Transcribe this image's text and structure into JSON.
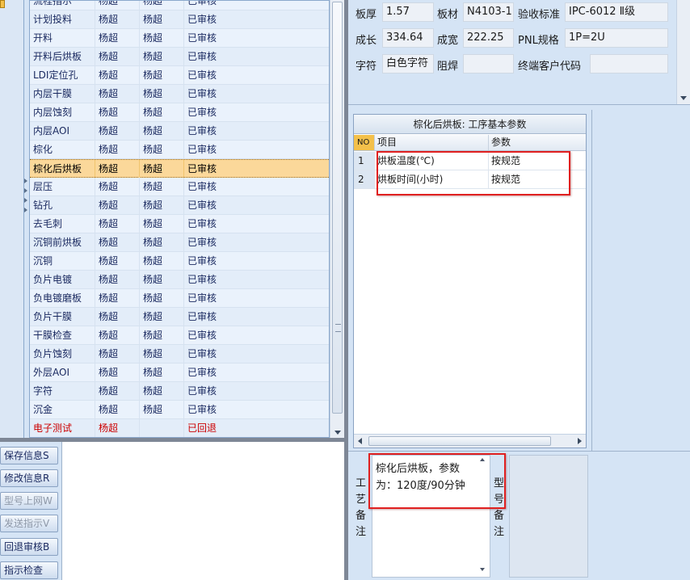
{
  "process_list": {
    "rows": [
      {
        "name": "流程指示",
        "c2": "杨超",
        "c3": "杨超",
        "status": "已审核"
      },
      {
        "name": "计划投料",
        "c2": "杨超",
        "c3": "杨超",
        "status": "已审核"
      },
      {
        "name": "开料",
        "c2": "杨超",
        "c3": "杨超",
        "status": "已审核"
      },
      {
        "name": "开料后烘板",
        "c2": "杨超",
        "c3": "杨超",
        "status": "已审核"
      },
      {
        "name": "LDI定位孔",
        "c2": "杨超",
        "c3": "杨超",
        "status": "已审核"
      },
      {
        "name": "内层干膜",
        "c2": "杨超",
        "c3": "杨超",
        "status": "已审核"
      },
      {
        "name": "内层蚀刻",
        "c2": "杨超",
        "c3": "杨超",
        "status": "已审核"
      },
      {
        "name": "内层AOI",
        "c2": "杨超",
        "c3": "杨超",
        "status": "已审核"
      },
      {
        "name": "棕化",
        "c2": "杨超",
        "c3": "杨超",
        "status": "已审核"
      },
      {
        "name": "棕化后烘板",
        "c2": "杨超",
        "c3": "杨超",
        "status": "已审核"
      },
      {
        "name": "层压",
        "c2": "杨超",
        "c3": "杨超",
        "status": "已审核"
      },
      {
        "name": "钻孔",
        "c2": "杨超",
        "c3": "杨超",
        "status": "已审核"
      },
      {
        "name": "去毛刺",
        "c2": "杨超",
        "c3": "杨超",
        "status": "已审核"
      },
      {
        "name": "沉铜前烘板",
        "c2": "杨超",
        "c3": "杨超",
        "status": "已审核"
      },
      {
        "name": "沉铜",
        "c2": "杨超",
        "c3": "杨超",
        "status": "已审核"
      },
      {
        "name": "负片电镀",
        "c2": "杨超",
        "c3": "杨超",
        "status": "已审核"
      },
      {
        "name": "负电镀磨板",
        "c2": "杨超",
        "c3": "杨超",
        "status": "已审核"
      },
      {
        "name": "负片干膜",
        "c2": "杨超",
        "c3": "杨超",
        "status": "已审核"
      },
      {
        "name": "干膜检查",
        "c2": "杨超",
        "c3": "杨超",
        "status": "已审核"
      },
      {
        "name": "负片蚀刻",
        "c2": "杨超",
        "c3": "杨超",
        "status": "已审核"
      },
      {
        "name": "外层AOI",
        "c2": "杨超",
        "c3": "杨超",
        "status": "已审核"
      },
      {
        "name": "字符",
        "c2": "杨超",
        "c3": "杨超",
        "status": "已审核"
      },
      {
        "name": "沉金",
        "c2": "杨超",
        "c3": "杨超",
        "status": "已审核"
      },
      {
        "name": "电子测试",
        "c2": "杨超",
        "c3": "",
        "status": "已回退"
      }
    ]
  },
  "buttons": {
    "save": "保存信息S",
    "modify": "修改信息R",
    "upload_model": "型号上网W",
    "send_instruction": "发送指示V",
    "return_review": "回退审核B",
    "instruction_check": "指示检查"
  },
  "info": {
    "thickness_label": "板厚",
    "thickness_value": "1.57",
    "material_label": "板材",
    "material_value": "N4103-1",
    "acceptance_label": "验收标准",
    "acceptance_value": "IPC-6012 Ⅱ级",
    "length_label": "成长",
    "length_value": "334.64",
    "width_label": "成宽",
    "width_value": "222.25",
    "pnl_label": "PNL规格",
    "pnl_value": "1P=2U",
    "legend_label": "字符",
    "legend_value": "白色字符",
    "solder_label": "阻焊",
    "solder_value": "",
    "customer_code_label": "终端客户代码",
    "customer_code_value": ""
  },
  "param_grid": {
    "title": "棕化后烘板: 工序基本参数",
    "headers": {
      "no": "NO",
      "item": "项目",
      "param": "参数"
    },
    "rows": [
      {
        "no": "1",
        "item": "烘板温度(℃)",
        "param": "按规范"
      },
      {
        "no": "2",
        "item": "烘板时间(小时)",
        "param": "按规范"
      }
    ]
  },
  "remarks": {
    "craft_label": "工艺备注",
    "craft_text": "棕化后烘板，参数为：120度/90分钟",
    "model_label": "型号备注"
  }
}
